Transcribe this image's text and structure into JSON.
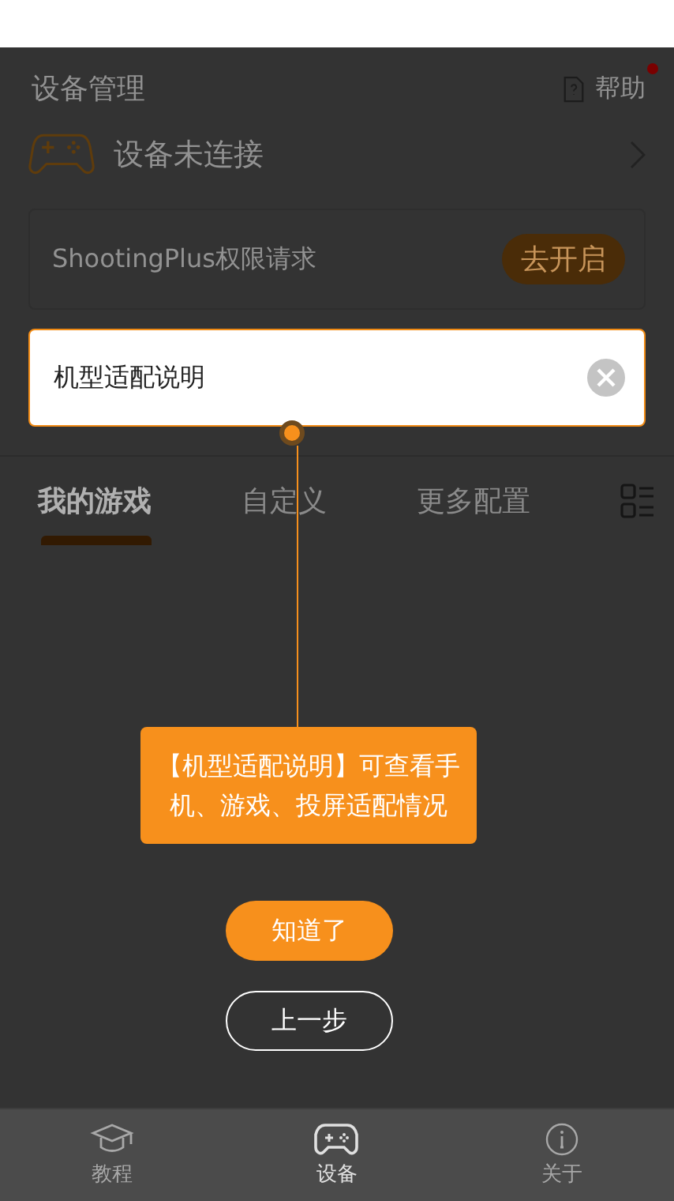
{
  "header": {
    "title": "设备管理",
    "help_label": "帮助",
    "help_notification": true
  },
  "device_row": {
    "label": "设备未连接"
  },
  "permission_card": {
    "text": "ShootingPlus权限请求",
    "button": "去开启"
  },
  "highlight": {
    "label": "机型适配说明"
  },
  "tabs": [
    {
      "label": "我的游戏",
      "selected": true
    },
    {
      "label": "自定义",
      "selected": false
    },
    {
      "label": "更多配置",
      "selected": false
    }
  ],
  "guide": {
    "tooltip": "【机型适配说明】可查看手机、游戏、投屏适配情况",
    "confirm_button": "知道了",
    "back_button": "上一步"
  },
  "bottom_nav": [
    {
      "kind": "tutorial",
      "label": "教程",
      "selected": false
    },
    {
      "kind": "device",
      "label": "设备",
      "selected": true
    },
    {
      "kind": "about",
      "label": "关于",
      "selected": false
    }
  ]
}
